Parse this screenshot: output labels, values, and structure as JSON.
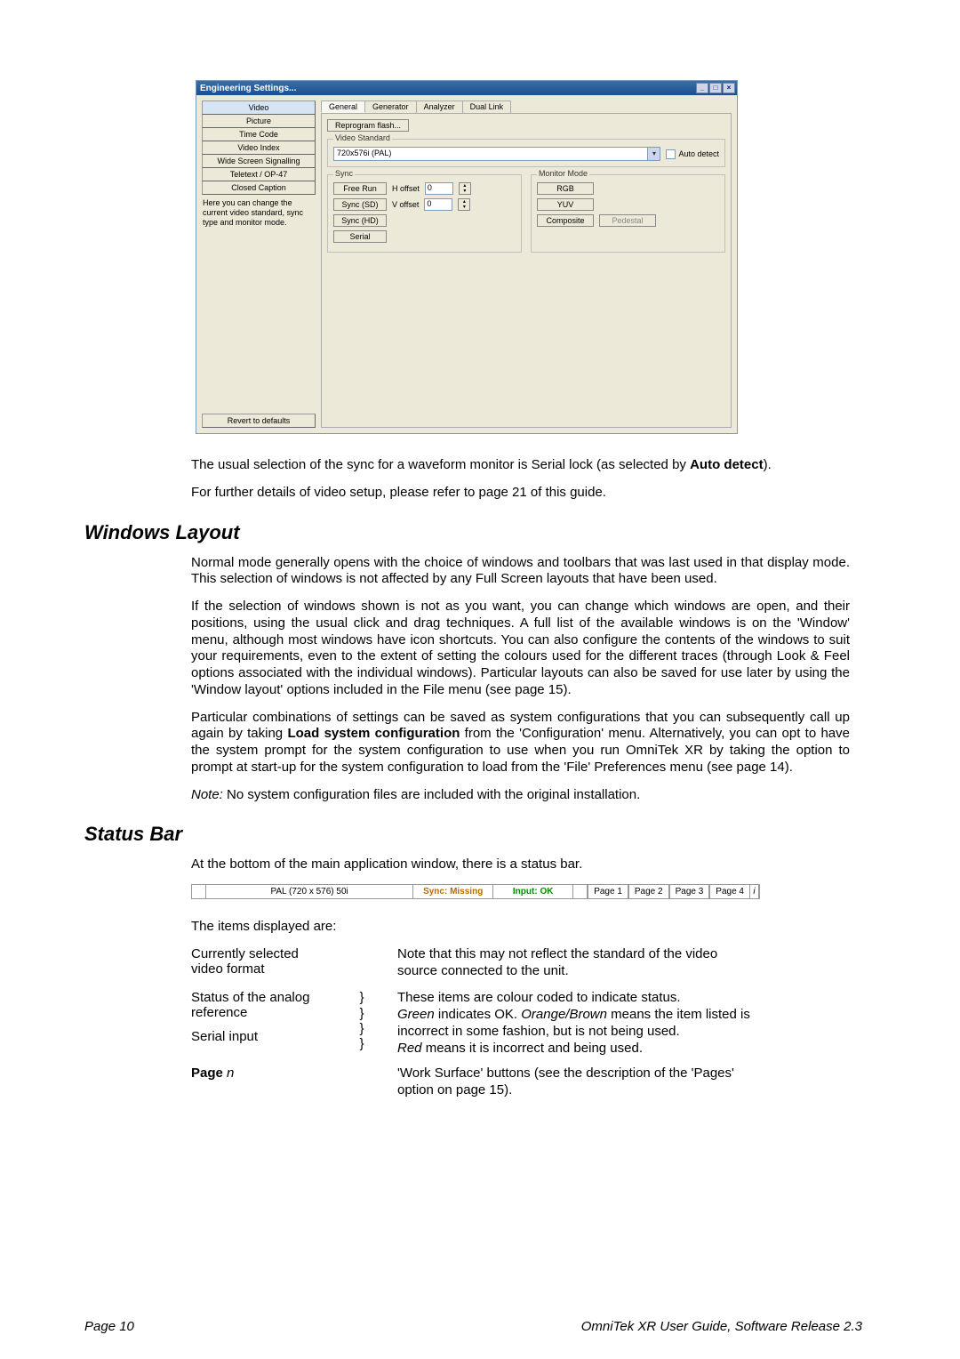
{
  "dialog": {
    "title": "Engineering Settings...",
    "sidebar": [
      "Video",
      "Picture",
      "Time Code",
      "Video Index",
      "Wide Screen Signalling",
      "Teletext / OP-47",
      "Closed Caption"
    ],
    "hint": "Here you can change the current video standard, sync type and monitor mode.",
    "revert_label": "Revert to defaults",
    "tabs": [
      "General",
      "Generator",
      "Analyzer",
      "Dual Link"
    ],
    "reprogram_label": "Reprogram flash...",
    "vs_group": "Video Standard",
    "vs_value": "720x576i (PAL)",
    "auto_detect": "Auto detect",
    "sync_group": "Sync",
    "sync_buttons": [
      "Free Run",
      "Sync (SD)",
      "Sync (HD)",
      "Serial"
    ],
    "h_offset_label": "H offset",
    "v_offset_label": "V offset",
    "offset_value": "0",
    "mon_group": "Monitor Mode",
    "mon_buttons": [
      "RGB",
      "YUV",
      "Composite",
      "Pedestal"
    ]
  },
  "body": {
    "line1a": "The usual selection of the sync for a waveform monitor is Serial lock (as selected by ",
    "line1b": "Auto detect",
    "line1c": ").",
    "line2": "For further details of video setup, please refer to page 21 of this guide.",
    "h_windows": "Windows Layout",
    "p1": "Normal mode generally opens with the choice of windows and toolbars that was last used in that display mode. This selection of windows is not affected by any Full Screen layouts that have been used.",
    "p2": "If the selection of windows shown is not as you want, you can change which windows are open, and their positions, using the usual click and drag techniques. A full list of the available windows is on the 'Window' menu, although most windows have icon shortcuts. You can also configure the contents of the windows to suit your requirements, even to the extent of setting the colours used for the different traces (through Look & Feel options associated with the individual windows). Particular layouts can also be saved for use later by using the 'Window layout' options included in the File menu (see page 15).",
    "p3a": "Particular combinations of settings can be saved as system configurations that you can subsequently call up again by taking ",
    "p3b": "Load system configuration",
    "p3c": " from the 'Configuration' menu. Alternatively, you can opt to have the system prompt for the system configuration to use when you run OmniTek XR by taking the option to prompt at start-up for the system configuration to load from the 'File' Preferences menu (see page 14).",
    "note_label": "Note:",
    "note_text": " No system configuration files are included with the original installation.",
    "h_status": "Status Bar",
    "status_intro": "At the bottom of the main application window, there is a status bar.",
    "items_intro": "The items displayed are:"
  },
  "statusbar": {
    "format": "PAL (720 x 576) 50i",
    "sync": "Sync: Missing",
    "input": "Input: OK",
    "pages": [
      "Page 1",
      "Page 2",
      "Page 3",
      "Page 4"
    ]
  },
  "items": [
    {
      "label": "Currently selected video format",
      "mid": "",
      "desc_plain": "Note that this may not reflect the standard of the video source connected to the unit."
    },
    {
      "label": "Status of the analog reference",
      "mid_count": 2
    },
    {
      "label": "Serial input",
      "mid_count": 2
    },
    {
      "label_bold": "Page ",
      "label_italic": "n",
      "desc_plain": "'Work Surface' buttons (see the description of the 'Pages' option on page 15)."
    }
  ],
  "status_desc": {
    "line1": "These items are colour coded to indicate status.",
    "green": "Green",
    "line2": " indicates OK. ",
    "orange": "Orange/Brown",
    "line3": " means the item listed is incorrect in some fashion, but is not being used.",
    "red": "Red",
    "line4": " means it is incorrect and being used."
  },
  "footer": {
    "left": "Page 10",
    "right": "OmniTek XR User Guide, Software Release 2.3"
  }
}
